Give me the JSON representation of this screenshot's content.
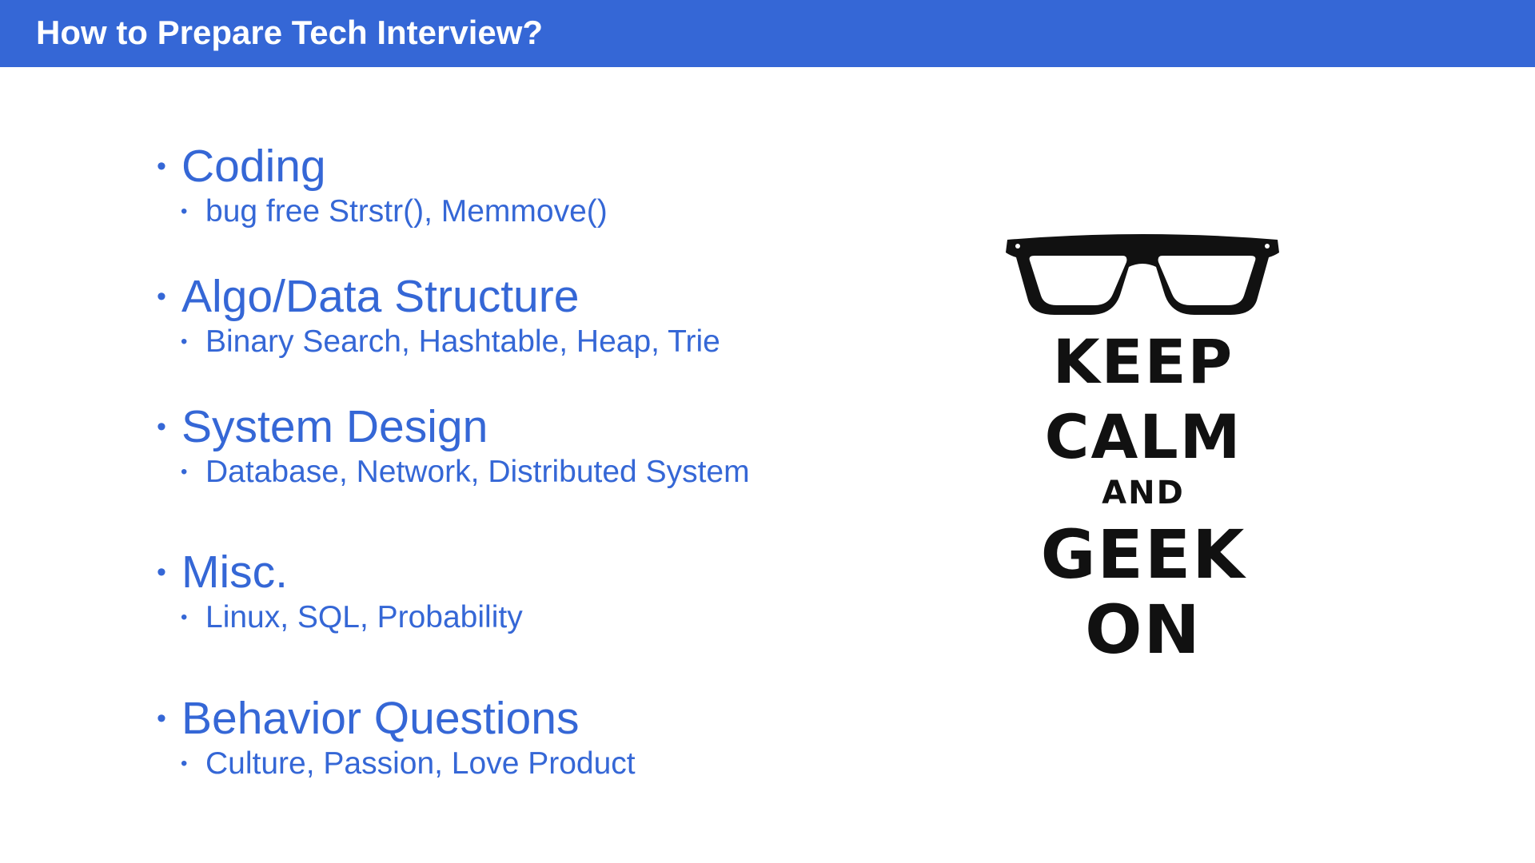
{
  "slide": {
    "title": "How to Prepare Tech Interview?"
  },
  "bullets": [
    {
      "heading": "Coding",
      "detail": "bug free Strstr(), Memmove()"
    },
    {
      "heading": "Algo/Data Structure",
      "detail": "Binary Search, Hashtable, Heap, Trie"
    },
    {
      "heading": "System Design",
      "detail": "Database, Network, Distributed System"
    },
    {
      "heading": "Misc.",
      "detail": "Linux, SQL, Probability"
    },
    {
      "heading": "Behavior Questions",
      "detail": "Culture, Passion, Love Product"
    }
  ],
  "poster": {
    "icon": "glasses-icon",
    "lines": [
      "KEEP",
      "CALM",
      "AND",
      "GEEK",
      "ON"
    ]
  },
  "colors": {
    "accent": "#3567d6",
    "poster_text": "#111111"
  }
}
